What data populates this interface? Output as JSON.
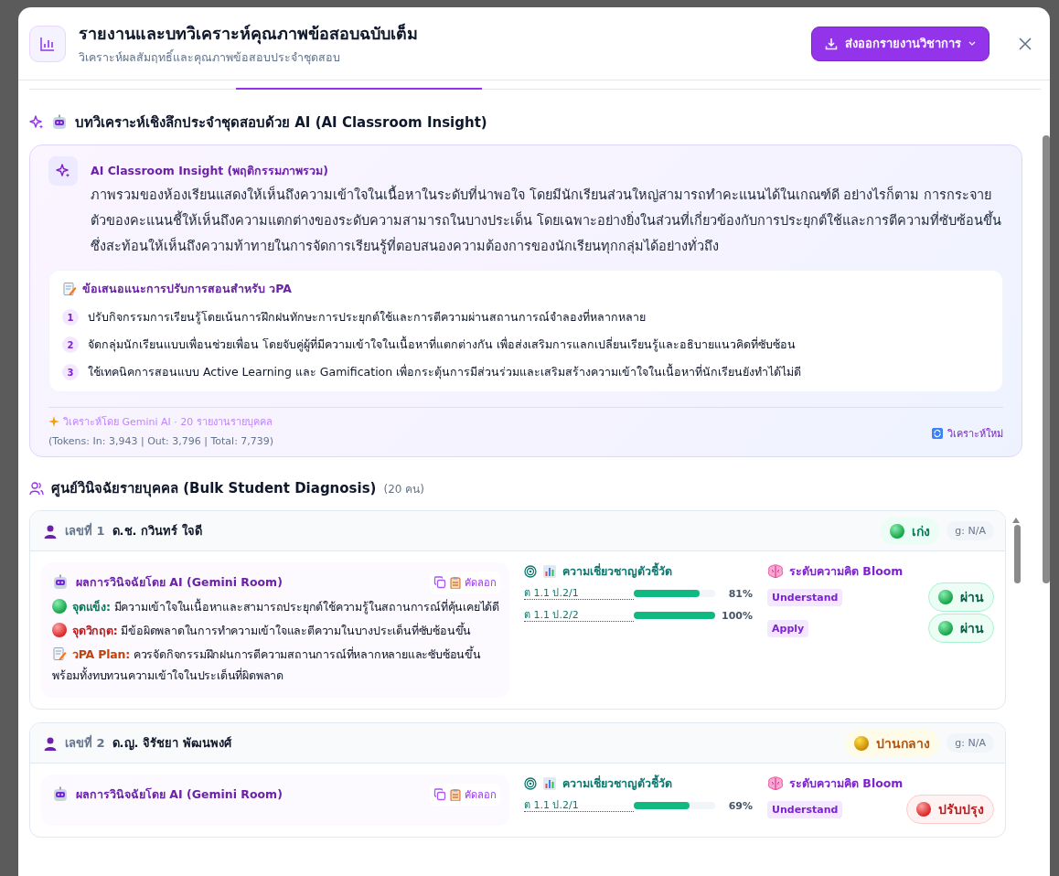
{
  "header": {
    "title": "รายงานและบทวิเคราะห์คุณภาพข้อสอบฉบับเต็ม",
    "subtitle": "วิเคราะห์ผลสัมฤทธิ์และคุณภาพข้อสอบประจำชุดสอบ",
    "export_button": "ส่งออกรายงานวิชาการ"
  },
  "insight_section": {
    "title": "บทวิเคราะห์เชิงลึกประจำชุดสอบด้วย AI (AI Classroom Insight)",
    "card_title": "AI Classroom Insight (พฤติกรรมภาพรวม)",
    "summary": "ภาพรวมของห้องเรียนแสดงให้เห็นถึงความเข้าใจในเนื้อหาในระดับที่น่าพอใจ โดยมีนักเรียนส่วนใหญ่สามารถทำคะแนนได้ในเกณฑ์ดี อย่างไรก็ตาม การกระจายตัวของคะแนนชี้ให้เห็นถึงความแตกต่างของระดับความสามารถในบางประเด็น โดยเฉพาะอย่างยิ่งในส่วนที่เกี่ยวข้องกับการประยุกต์ใช้และการตีความที่ซับซ้อนขึ้น ซึ่งสะท้อนให้เห็นถึงความท้าทายในการจัดการเรียนรู้ที่ตอบสนองความต้องการของนักเรียนทุกกลุ่มได้อย่างทั่วถึง",
    "recommendations": {
      "title": "ข้อเสนอแนะการปรับการสอนสำหรับ วPA",
      "items": [
        {
          "number": "1",
          "text": "ปรับกิจกรรมการเรียนรู้โดยเน้นการฝึกฝนทักษะการประยุกต์ใช้และการตีความผ่านสถานการณ์จำลองที่หลากหลาย"
        },
        {
          "number": "2",
          "text": "จัดกลุ่มนักเรียนแบบเพื่อนช่วยเพื่อน โดยจับคู่ผู้ที่มีความเข้าใจในเนื้อหาที่แตกต่างกัน เพื่อส่งเสริมการแลกเปลี่ยนเรียนรู้และอธิบายแนวคิดที่ซับซ้อน"
        },
        {
          "number": "3",
          "text": "ใช้เทคนิคการสอนแบบ Active Learning และ Gamification เพื่อกระตุ้นการมีส่วนร่วมและเสริมสร้างความเข้าใจในเนื้อหาที่นักเรียนยังทำได้ไม่ดี"
        }
      ]
    },
    "footer": {
      "credit": "วิเคราะห์โดย Gemini AI · 20 รายงานรายบุคคล",
      "tokens": "(Tokens: In: 3,943 | Out: 3,796 | Total: 7,739)",
      "reanalyze_button": "วิเคราะห์ใหม่"
    }
  },
  "diagnosis_section": {
    "title": "ศูนย์วินิจฉัยรายบุคคล (Bulk Student Diagnosis)",
    "count": "(20 คน)",
    "students": [
      {
        "number_label": "เลขที่ 1",
        "name": "ด.ช. กวินทร์ ใจดี",
        "grade": {
          "label": "เก่ง",
          "kind": "good"
        },
        "g_value": "g: N/A",
        "diagnosis": {
          "title": "ผลการวินิจฉัยโดย AI (Gemini Room)",
          "copy_button": "คัดลอก",
          "points": [
            {
              "kind": "strength",
              "label": "จุดแข็ง:",
              "text": "มีความเข้าใจในเนื้อหาและสามารถประยุกต์ใช้ความรู้ในสถานการณ์ที่คุ้นเคยได้ดี"
            },
            {
              "kind": "critical",
              "label": "จุดวิกฤต:",
              "text": "มีข้อผิดพลาดในการทำความเข้าใจและตีความในบางประเด็นที่ซับซ้อนขึ้น"
            },
            {
              "kind": "plan",
              "label": "วPA Plan:",
              "text": "ควรจัดกิจกรรมฝึกฝนการตีความสถานการณ์ที่หลากหลายและซับซ้อนขึ้น พร้อมทั้งทบทวนความเข้าใจในประเด็นที่ผิดพลาด"
            }
          ]
        },
        "indicators": {
          "title": "ความเชี่ยวชาญตัวชี้วัด",
          "items": [
            {
              "code": "ต 1.1 ป.2/1",
              "level": 0.81,
              "reading": "81%"
            },
            {
              "code": "ต 1.1 ป.2/2",
              "level": 1.0,
              "reading": "100%"
            }
          ]
        },
        "bloom": {
          "title": "ระดับความคิด Bloom",
          "items": [
            {
              "level_name": "Understand",
              "result": "ผ่าน",
              "passed": true
            },
            {
              "level_name": "Apply",
              "result": "ผ่าน",
              "passed": true
            }
          ]
        }
      },
      {
        "number_label": "เลขที่ 2",
        "name": "ด.ญ. จิรัชยา พัฒนพงศ์",
        "grade": {
          "label": "ปานกลาง",
          "kind": "medium"
        },
        "g_value": "g: N/A",
        "diagnosis": {
          "title": "ผลการวินิจฉัยโดย AI (Gemini Room)",
          "copy_button": "คัดลอก"
        },
        "indicators": {
          "title": "ความเชี่ยวชาญตัวชี้วัด",
          "items": [
            {
              "code": "ต 1.1 ป.2/1",
              "level": 0.69,
              "reading": "69%"
            }
          ]
        },
        "bloom": {
          "title": "ระดับความคิด Bloom",
          "items": [
            {
              "level_name": "Understand",
              "result": "ปรับปรุง",
              "passed": false
            }
          ]
        }
      }
    ]
  }
}
